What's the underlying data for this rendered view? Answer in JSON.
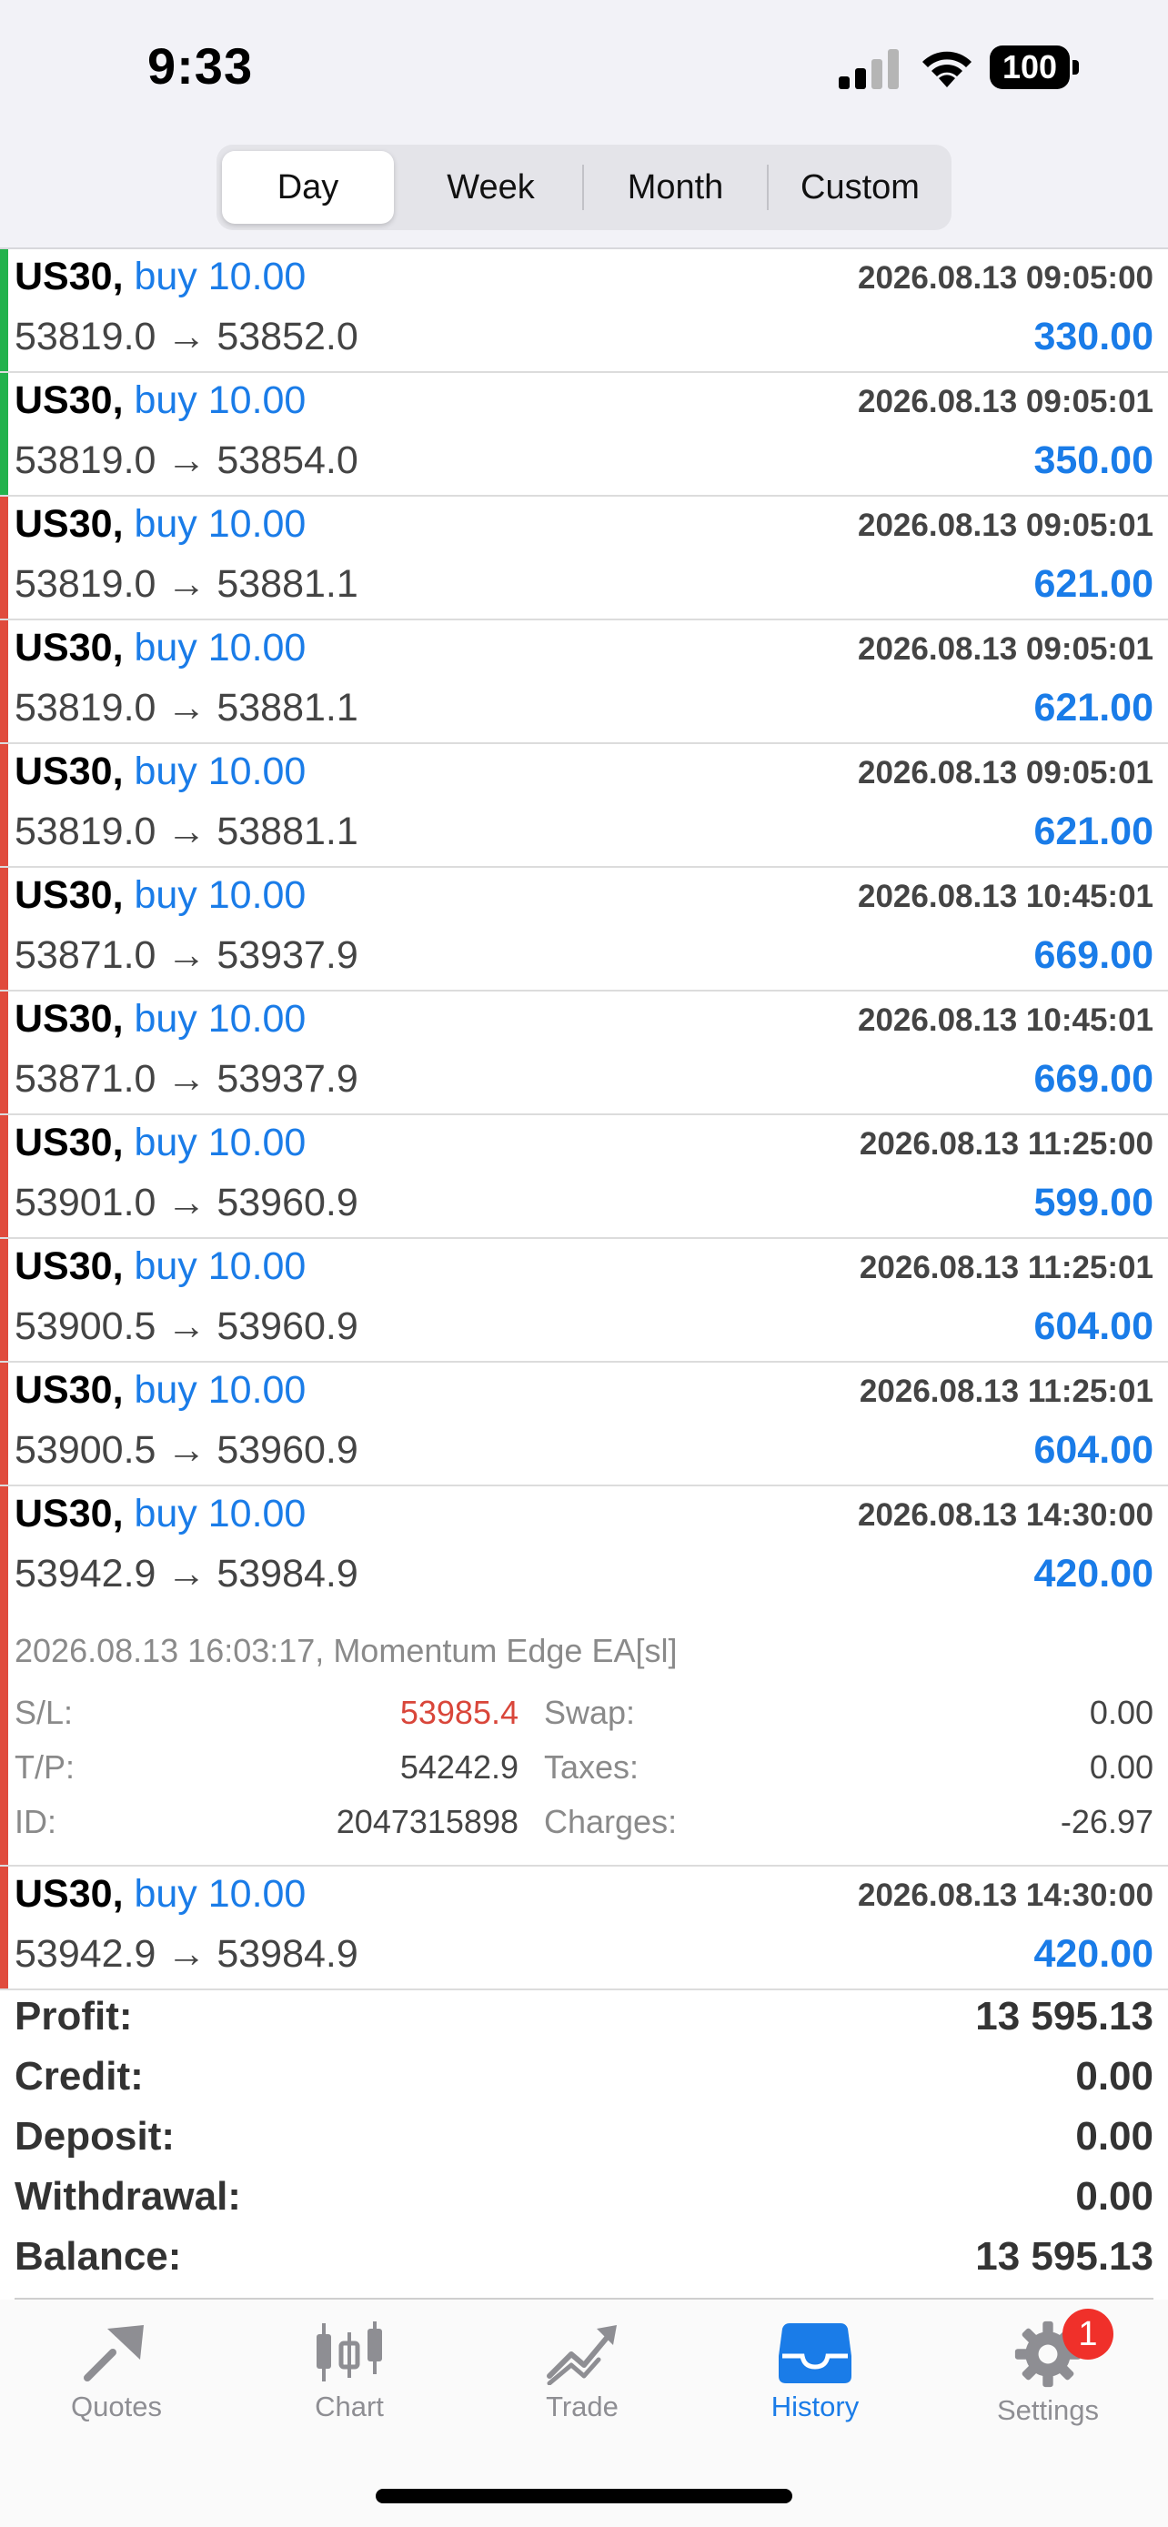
{
  "status_bar": {
    "time": "9:33",
    "battery": "100"
  },
  "period_tabs": [
    {
      "label": "Day",
      "active": true
    },
    {
      "label": "Week",
      "active": false
    },
    {
      "label": "Month",
      "active": false
    },
    {
      "label": "Custom",
      "active": false
    }
  ],
  "colors": {
    "accent": "#1a7ce8",
    "green": "#22b24c",
    "red": "#e04b3c",
    "sl": "#d9463a"
  },
  "deals": [
    {
      "symbol": "US30,",
      "direction": "buy 10.00",
      "time": "2026.08.13 09:05:00",
      "prices": "53819.0 → 53852.0",
      "profit": "330.00",
      "bar": "green"
    },
    {
      "symbol": "US30,",
      "direction": "buy 10.00",
      "time": "2026.08.13 09:05:01",
      "prices": "53819.0 → 53854.0",
      "profit": "350.00",
      "bar": "green"
    },
    {
      "symbol": "US30,",
      "direction": "buy 10.00",
      "time": "2026.08.13 09:05:01",
      "prices": "53819.0 → 53881.1",
      "profit": "621.00",
      "bar": "red"
    },
    {
      "symbol": "US30,",
      "direction": "buy 10.00",
      "time": "2026.08.13 09:05:01",
      "prices": "53819.0 → 53881.1",
      "profit": "621.00",
      "bar": "red"
    },
    {
      "symbol": "US30,",
      "direction": "buy 10.00",
      "time": "2026.08.13 09:05:01",
      "prices": "53819.0 → 53881.1",
      "profit": "621.00",
      "bar": "red"
    },
    {
      "symbol": "US30,",
      "direction": "buy 10.00",
      "time": "2026.08.13 10:45:01",
      "prices": "53871.0 → 53937.9",
      "profit": "669.00",
      "bar": "red"
    },
    {
      "symbol": "US30,",
      "direction": "buy 10.00",
      "time": "2026.08.13 10:45:01",
      "prices": "53871.0 → 53937.9",
      "profit": "669.00",
      "bar": "red"
    },
    {
      "symbol": "US30,",
      "direction": "buy 10.00",
      "time": "2026.08.13 11:25:00",
      "prices": "53901.0 → 53960.9",
      "profit": "599.00",
      "bar": "red"
    },
    {
      "symbol": "US30,",
      "direction": "buy 10.00",
      "time": "2026.08.13 11:25:01",
      "prices": "53900.5 → 53960.9",
      "profit": "604.00",
      "bar": "red"
    },
    {
      "symbol": "US30,",
      "direction": "buy 10.00",
      "time": "2026.08.13 11:25:01",
      "prices": "53900.5 → 53960.9",
      "profit": "604.00",
      "bar": "red"
    },
    {
      "symbol": "US30,",
      "direction": "buy 10.00",
      "time": "2026.08.13 14:30:00",
      "prices": "53942.9 → 53984.9",
      "profit": "420.00",
      "bar": "red",
      "details": {
        "comment": "2026.08.13 16:03:17, Momentum Edge EA[sl]",
        "sl_label": "S/L:",
        "sl": "53985.4",
        "tp_label": "T/P:",
        "tp": "54242.9",
        "id_label": "ID:",
        "id": "2047315898",
        "swap_label": "Swap:",
        "swap": "0.00",
        "taxes_label": "Taxes:",
        "taxes": "0.00",
        "charges_label": "Charges:",
        "charges": "-26.97"
      }
    },
    {
      "symbol": "US30,",
      "direction": "buy 10.00",
      "time": "2026.08.13 14:30:00",
      "prices": "53942.9 → 53984.9",
      "profit": "420.00",
      "bar": "red"
    }
  ],
  "summary": [
    {
      "label": "Profit:",
      "value": "13 595.13"
    },
    {
      "label": "Credit:",
      "value": "0.00"
    },
    {
      "label": "Deposit:",
      "value": "0.00"
    },
    {
      "label": "Withdrawal:",
      "value": "0.00"
    },
    {
      "label": "Balance:",
      "value": "13 595.13"
    }
  ],
  "tab_bar": [
    {
      "label": "Quotes",
      "icon": "quotes-icon",
      "active": false
    },
    {
      "label": "Chart",
      "icon": "chart-icon",
      "active": false
    },
    {
      "label": "Trade",
      "icon": "trade-icon",
      "active": false
    },
    {
      "label": "History",
      "icon": "history-icon",
      "active": true
    },
    {
      "label": "Settings",
      "icon": "settings-icon",
      "active": false,
      "badge": "1"
    }
  ]
}
